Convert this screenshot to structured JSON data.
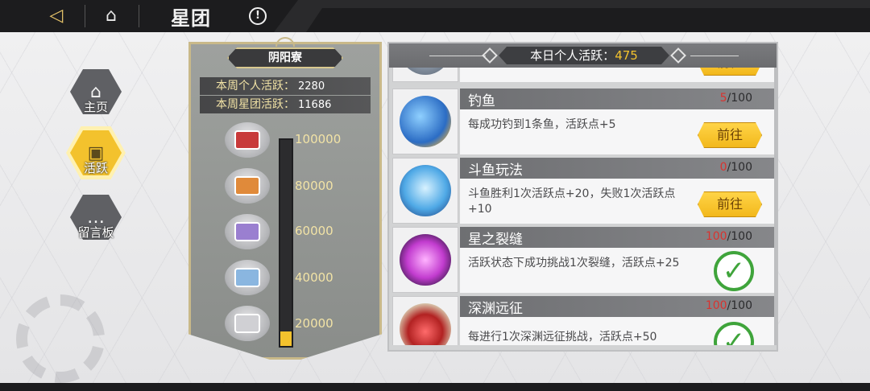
{
  "top_bar": {
    "back_icon": "back-arrow-icon",
    "home_icon": "home-icon",
    "title": "星团",
    "info_glyph": "!"
  },
  "nav": {
    "items": [
      {
        "label": "主页",
        "icon": "home-icon",
        "glyph": "⌂",
        "active": false
      },
      {
        "label": "活跃",
        "icon": "activity-icon",
        "glyph": "▣",
        "active": true
      },
      {
        "label": "留言板",
        "icon": "message-board-icon",
        "glyph": "…",
        "active": false
      }
    ]
  },
  "reward_panel": {
    "name": "阴阳寮",
    "weekly_personal_label": "本周个人活跃：",
    "weekly_personal_value": "2280",
    "weekly_group_label": "本周星团活跃：",
    "weekly_group_value": "11686",
    "progress_fraction": 0.0228,
    "milestones": [
      "100000",
      "80000",
      "60000",
      "40000",
      "20000"
    ]
  },
  "daily_panel": {
    "title_label": "本日个人活跃：",
    "title_value": "475",
    "partial_go_label": "前往",
    "tasks": [
      {
        "name": "钓鱼",
        "current": "5",
        "total": "/100",
        "desc": "每成功钓到1条鱼，活跃点+5",
        "status": "go",
        "button": "前往",
        "icon": "fishing-icon"
      },
      {
        "name": "斗鱼玩法",
        "current": "0",
        "total": "/100",
        "desc": "斗鱼胜利1次活跃点+20，失败1次活跃点+10",
        "status": "go",
        "button": "前往",
        "icon": "fish-battle-icon"
      },
      {
        "name": "星之裂缝",
        "current": "100",
        "total": "/100",
        "desc": "活跃状态下成功挑战1次裂缝，活跃点+25",
        "status": "done",
        "button": "",
        "icon": "star-rift-icon"
      },
      {
        "name": "深渊远征",
        "current": "100",
        "total": "/100",
        "desc": "每进行1次深渊远征挑战，活跃点+50",
        "status": "done",
        "button": "",
        "icon": "abyss-expedition-icon"
      }
    ]
  },
  "colors": {
    "accent_gold": "#f3c22d",
    "count_red": "#d9332f",
    "done_green": "#3fa43b"
  }
}
